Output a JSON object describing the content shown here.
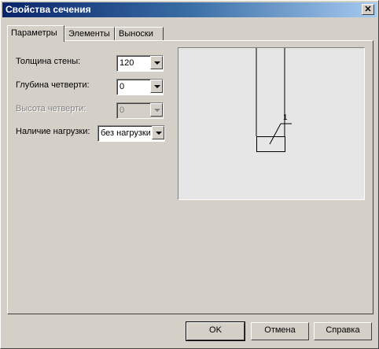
{
  "window": {
    "title": "Свойства сечения",
    "close_glyph": "✕"
  },
  "tabs": [
    {
      "label": "Параметры",
      "active": true
    },
    {
      "label": "Элементы",
      "active": false
    },
    {
      "label": "Выноски",
      "active": false
    }
  ],
  "params": {
    "wall_thickness": {
      "label": "Толщина стены:",
      "value": "120"
    },
    "quarter_depth": {
      "label": "Глубина четверти:",
      "value": "0"
    },
    "quarter_height": {
      "label": "Высота четверти:",
      "value": "0",
      "disabled": true
    },
    "load": {
      "label": "Наличие нагрузки:",
      "value": "без нагрузки"
    }
  },
  "preview": {
    "callout_label": "1"
  },
  "buttons": {
    "ok": "OK",
    "cancel": "Отмена",
    "help": "Справка"
  },
  "colors": {
    "title_start": "#0a246a",
    "title_end": "#a6caf0",
    "face": "#d4d0c8",
    "preview_bg": "#e6e6e6"
  }
}
